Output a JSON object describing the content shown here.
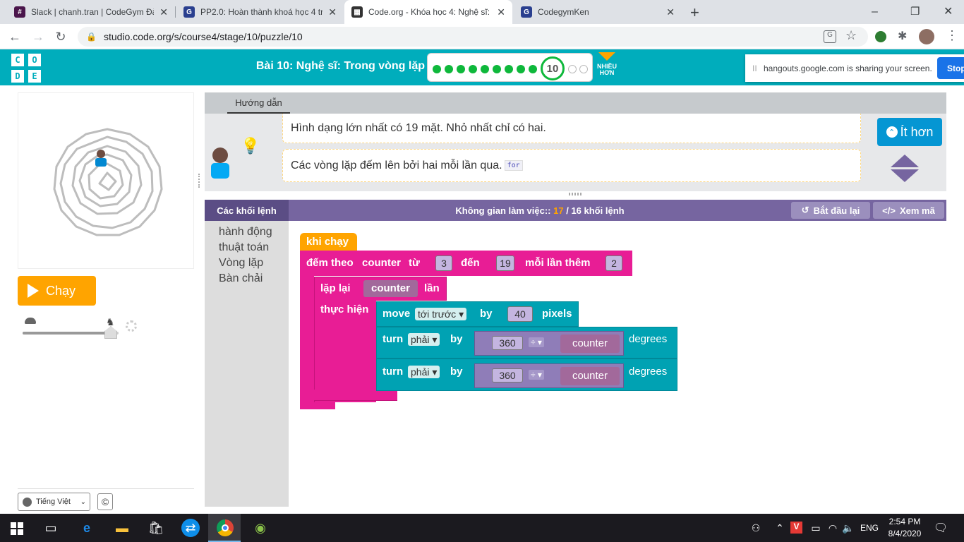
{
  "browser": {
    "tabs": [
      {
        "title": "Slack | chanh.tran | CodeGym Đà",
        "icon": "slack-icon",
        "color": "#4a154b"
      },
      {
        "title": "PP2.0: Hoàn thành khoá học 4 trê",
        "icon": "g-icon",
        "color": "#2a3f8f"
      },
      {
        "title": "Code.org - Khóa học 4: Nghệ sĩ: T",
        "icon": "codeorg-icon",
        "color": "#333333",
        "active": true
      },
      {
        "title": "CodegymKen",
        "icon": "g-icon",
        "color": "#2a3f8f"
      }
    ],
    "close_glyph": "✕",
    "new_tab": "+",
    "url": "studio.code.org/s/course4/stage/10/puzzle/10",
    "window_controls": [
      "–",
      "❐",
      "✕"
    ]
  },
  "header": {
    "logo_letters": [
      "C",
      "O",
      "D",
      "E"
    ],
    "title": "Bài 10: Nghệ sĩ: Trong vòng lặp",
    "current_puzzle": "10",
    "completed_puzzles": 9,
    "remaining_puzzles": 2,
    "more_label_line1": "NHIỀU",
    "more_label_line2": "HƠN",
    "share_notice": "hangouts.google.com is sharing your screen.",
    "share_pause": "II",
    "share_stop": "Stop"
  },
  "left": {
    "run_label": "Chạy",
    "language": "Tiếng Việt",
    "copyright": "©",
    "speed_slider_level": 0.92
  },
  "instructions": {
    "tab": "Hướng dẫn",
    "lines": [
      {
        "text": "Hình dạng lớn nhất có 19 mặt. Nhỏ nhất chỉ có hai.",
        "code": ""
      },
      {
        "text": "Các vòng lặp đếm lên bởi hai mỗi lần qua.",
        "code": "for"
      }
    ],
    "less_button": "Ít hơn"
  },
  "workspace": {
    "toolbox_header": "Các khối lệnh",
    "title_prefix": "Không gian làm việc::",
    "block_count": "17",
    "block_limit": "/ 16 khối lệnh",
    "reset_button": "Bắt đầu lại",
    "show_code_button": "Xem mã",
    "categories": [
      "hành động",
      "thuật toán",
      "Vòng lặp",
      "Bàn chải"
    ],
    "blocks": {
      "when_run": "khi chạy",
      "for_label": "đếm theo",
      "for_var": "counter",
      "from_label": "từ",
      "from_value": "3",
      "to_label": "đến",
      "to_value": "19",
      "by_label": "mỗi lần thêm",
      "by_value": "2",
      "repeat_label": "lặp lại",
      "repeat_var": "counter",
      "times_label": "lần",
      "do_label": "thực hiện",
      "move_label": "move",
      "move_dir": "tới trước ▾",
      "move_by": "by",
      "move_value": "40",
      "move_unit": "pixels",
      "turn1_label": "turn",
      "turn1_dir": "phải ▾",
      "turn1_by": "by",
      "turn1_num": "360",
      "turn1_op": "÷ ▾",
      "turn1_var": "counter",
      "turn1_unit": "degrees",
      "turn2_label": "turn",
      "turn2_dir": "phải ▾",
      "turn2_by": "by",
      "turn2_num": "360",
      "turn2_op": "÷ ▾",
      "turn2_var": "counter",
      "turn2_unit": "degrees"
    }
  },
  "taskbar": {
    "lang": "ENG",
    "time": "2:54 PM",
    "date": "8/4/2020"
  }
}
